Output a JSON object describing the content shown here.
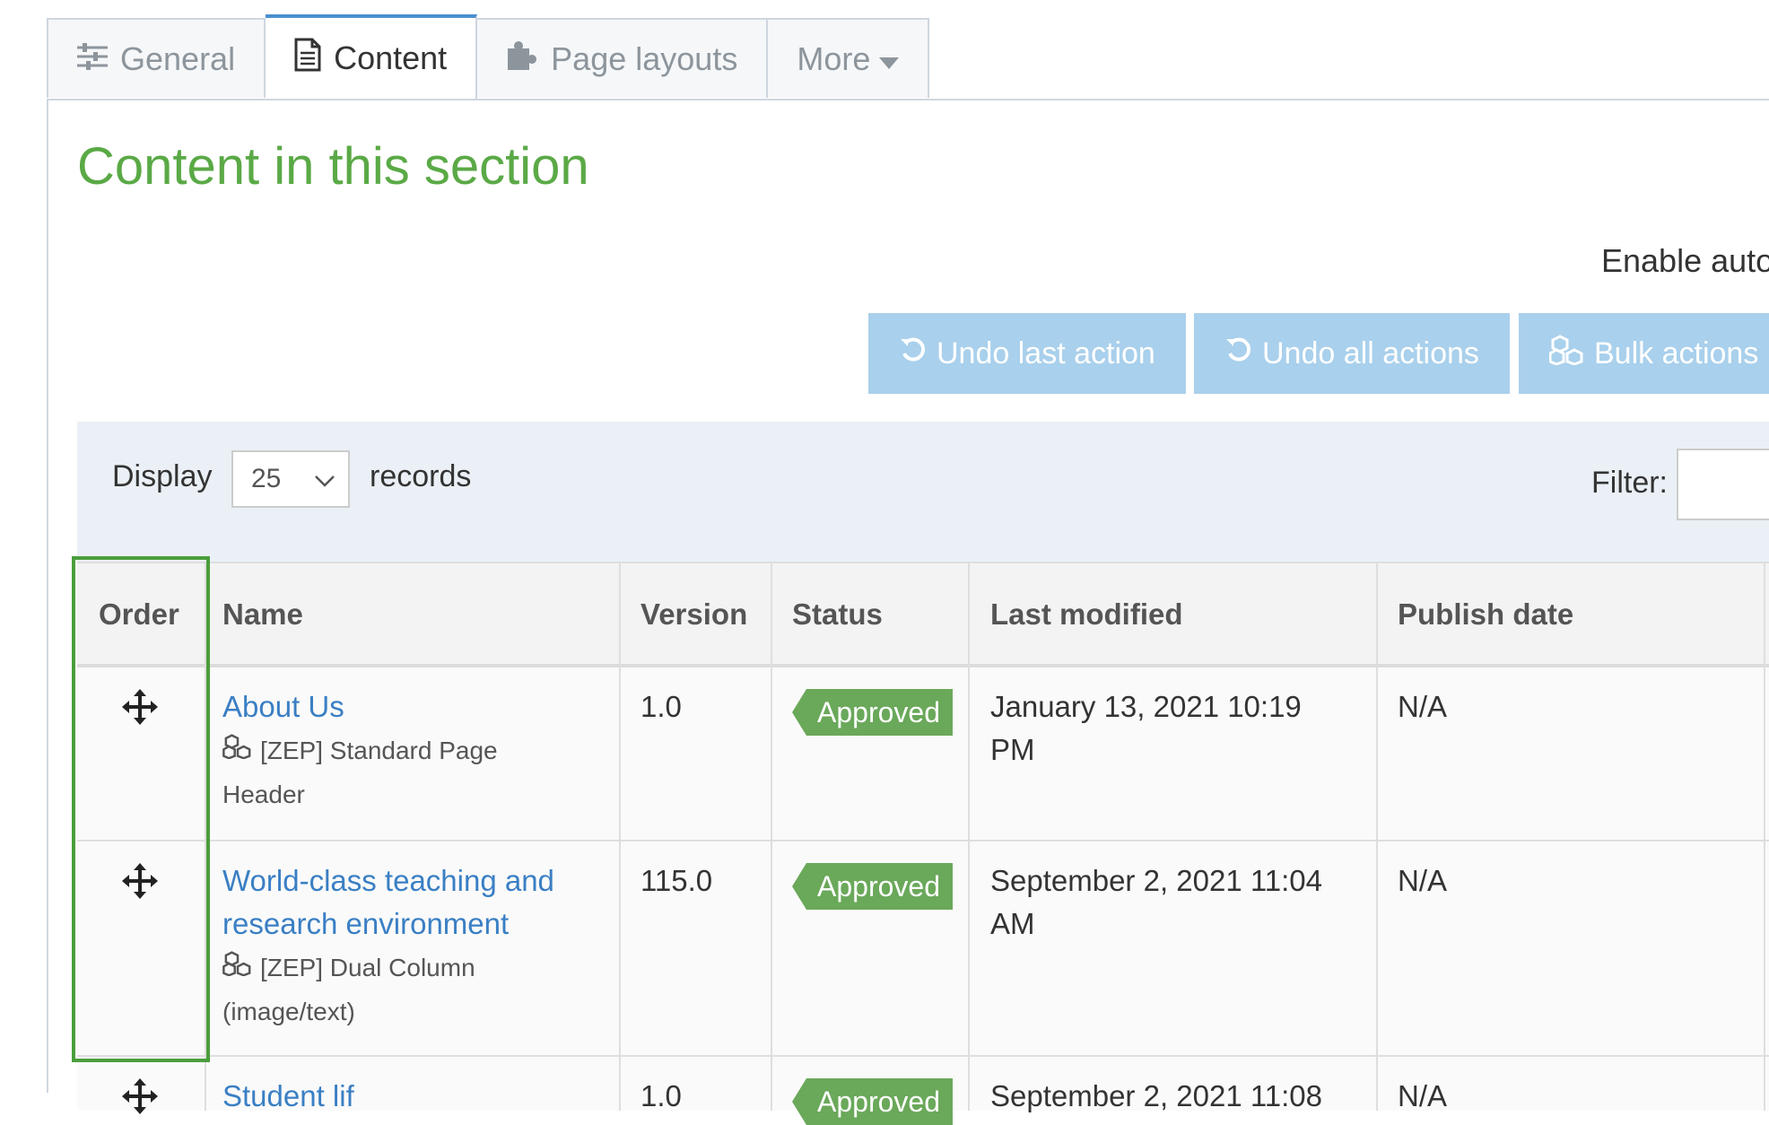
{
  "tabs": [
    {
      "label": "General",
      "icon": "sliders-icon"
    },
    {
      "label": "Content",
      "icon": "document-icon"
    },
    {
      "label": "Page layouts",
      "icon": "puzzle-icon"
    },
    {
      "label": "More",
      "icon": "caret-down-icon"
    }
  ],
  "section_title": "Content in this section",
  "enable_text": "Enable auto",
  "actions": {
    "undo_last": "Undo last action",
    "undo_all": "Undo all actions",
    "bulk": "Bulk actions"
  },
  "display": {
    "label": "Display",
    "value": "25",
    "suffix": "records",
    "filter_label": "Filter:"
  },
  "table": {
    "headers": [
      "Order",
      "Name",
      "Version",
      "Status",
      "Last modified",
      "Publish date"
    ],
    "rows": [
      {
        "name": "About Us",
        "type": "[ZEP] Standard Page",
        "type2": "Header",
        "version": "1.0",
        "status": "Approved",
        "modified1": "January 13, 2021 10:19",
        "modified2": "PM",
        "publish": "N/A"
      },
      {
        "name": "World-class teaching and",
        "name2": "research environment",
        "type": "[ZEP] Dual Column",
        "type2": "(image/text)",
        "version": "115.0",
        "status": "Approved",
        "modified1": "September 2, 2021 11:04",
        "modified2": "AM",
        "publish": "N/A"
      },
      {
        "name": "Student lif",
        "version": "1.0",
        "status": "Approved",
        "modified1": "September 2, 2021 11:08",
        "publish": "N/A"
      }
    ]
  },
  "colors": {
    "title_green": "#5aa946",
    "tab_active_border": "#4a8fd0",
    "button_bg": "#a9d0ec",
    "badge_green": "#6aa85a",
    "link_blue": "#3a7fc4",
    "highlight_green": "#4a9e3b"
  }
}
